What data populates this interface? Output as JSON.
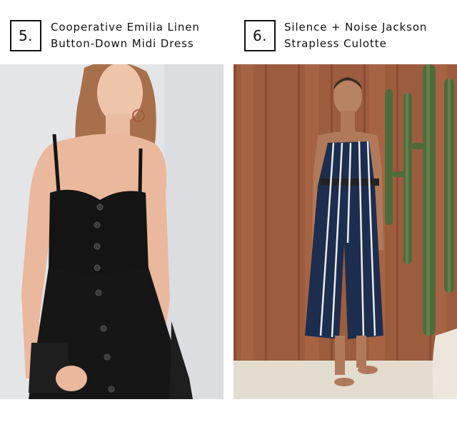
{
  "items": [
    {
      "number": "5.",
      "title_line1": "Cooperative Emilia Linen",
      "title_line2": "Button-Down Midi Dress",
      "image_description_icon": "black-button-down-dress-photo"
    },
    {
      "number": "6.",
      "title_line1": "Silence + Noise Jackson",
      "title_line2": "Strapless Culotte",
      "image_description_icon": "striped-strapless-culotte-photo"
    }
  ],
  "colors": {
    "text": "#111111",
    "background": "#ffffff",
    "dress": "#141414",
    "jumpsuit_navy": "#1d2d4e",
    "wood_panel": "#9c5c3e",
    "cactus": "#4f6b3a"
  }
}
